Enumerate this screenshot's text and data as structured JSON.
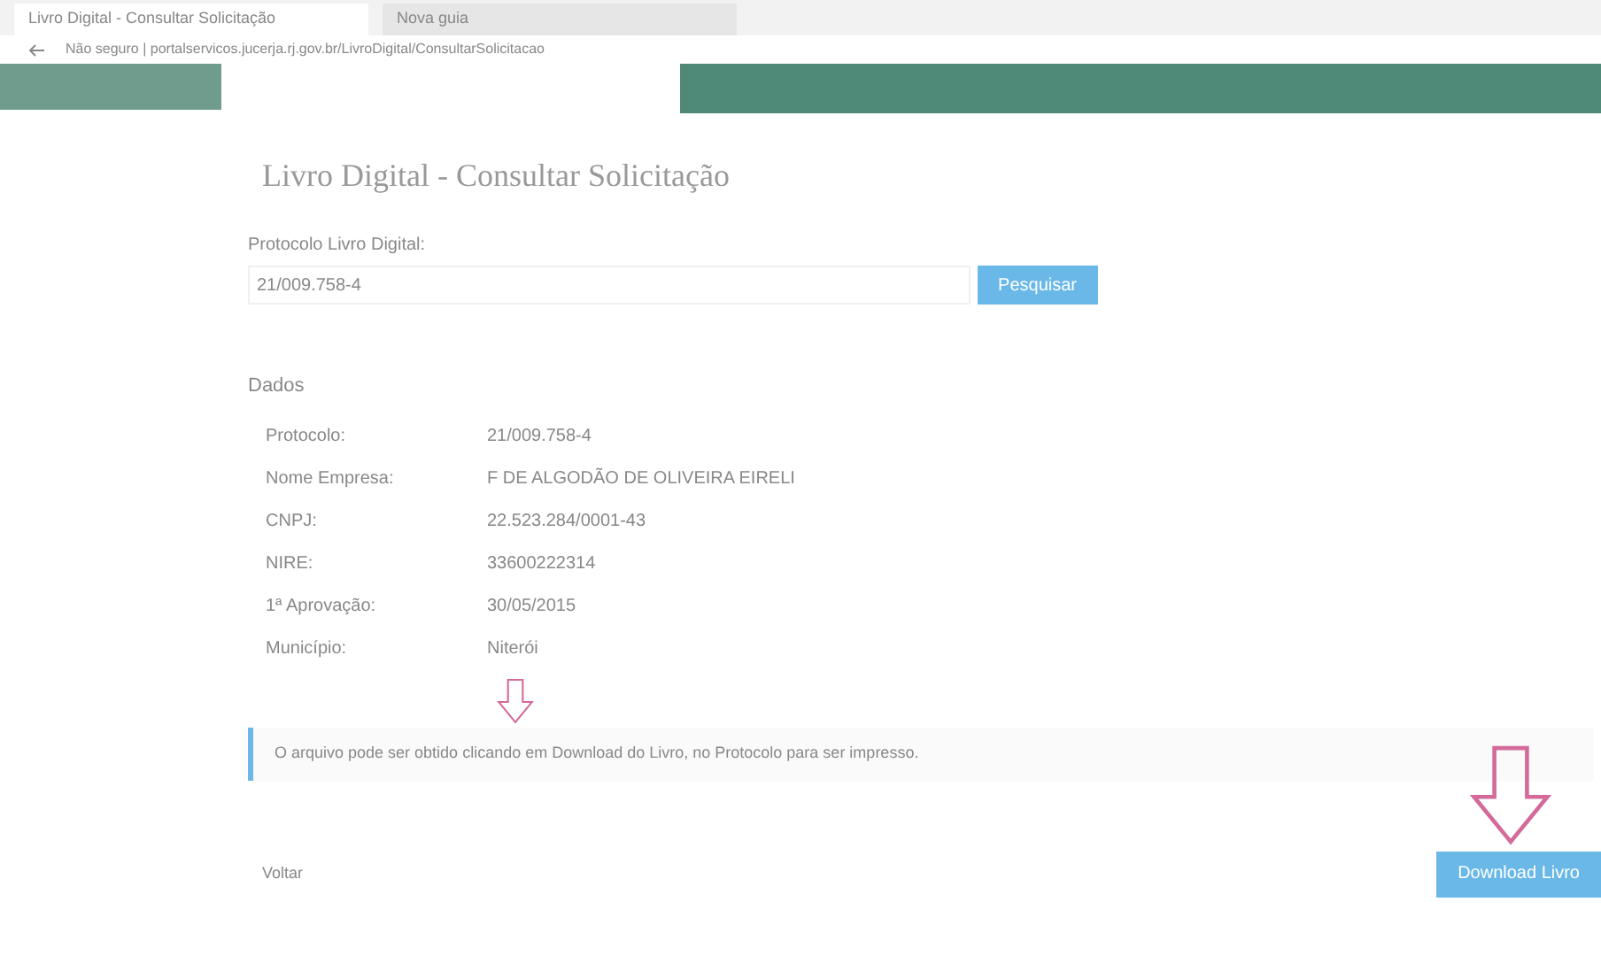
{
  "browser": {
    "tabs": [
      {
        "title": "Livro Digital - Consultar Solicitação",
        "selected": true
      },
      {
        "title": "Nova guia",
        "selected": false
      }
    ],
    "address": "Não seguro | portalservicos.jucerja.rj.gov.br/LivroDigital/ConsultarSolicitacao"
  },
  "page": {
    "title": "Livro Digital - Consultar Solicitação",
    "search": {
      "label": "Protocolo Livro Digital:",
      "value": "21/009.758-4",
      "button": "Pesquisar"
    },
    "section": "Dados",
    "fields": [
      {
        "label": "Protocolo:",
        "value": "21/009.758-4"
      },
      {
        "label": "Nome Empresa:",
        "value": "F DE ALGODÃO DE OLIVEIRA EIRELI"
      },
      {
        "label": "CNPJ:",
        "value": "22.523.284/0001-43"
      },
      {
        "label": "NIRE:",
        "value": "33600222314"
      },
      {
        "label": "1ª Aprovação:",
        "value": "30/05/2015"
      },
      {
        "label": "Município:",
        "value": "Niterói"
      }
    ],
    "info": "O arquivo pode ser obtido clicando em Download do Livro, no Protocolo para ser impresso.",
    "back": "Voltar",
    "download": "Download Livro"
  }
}
